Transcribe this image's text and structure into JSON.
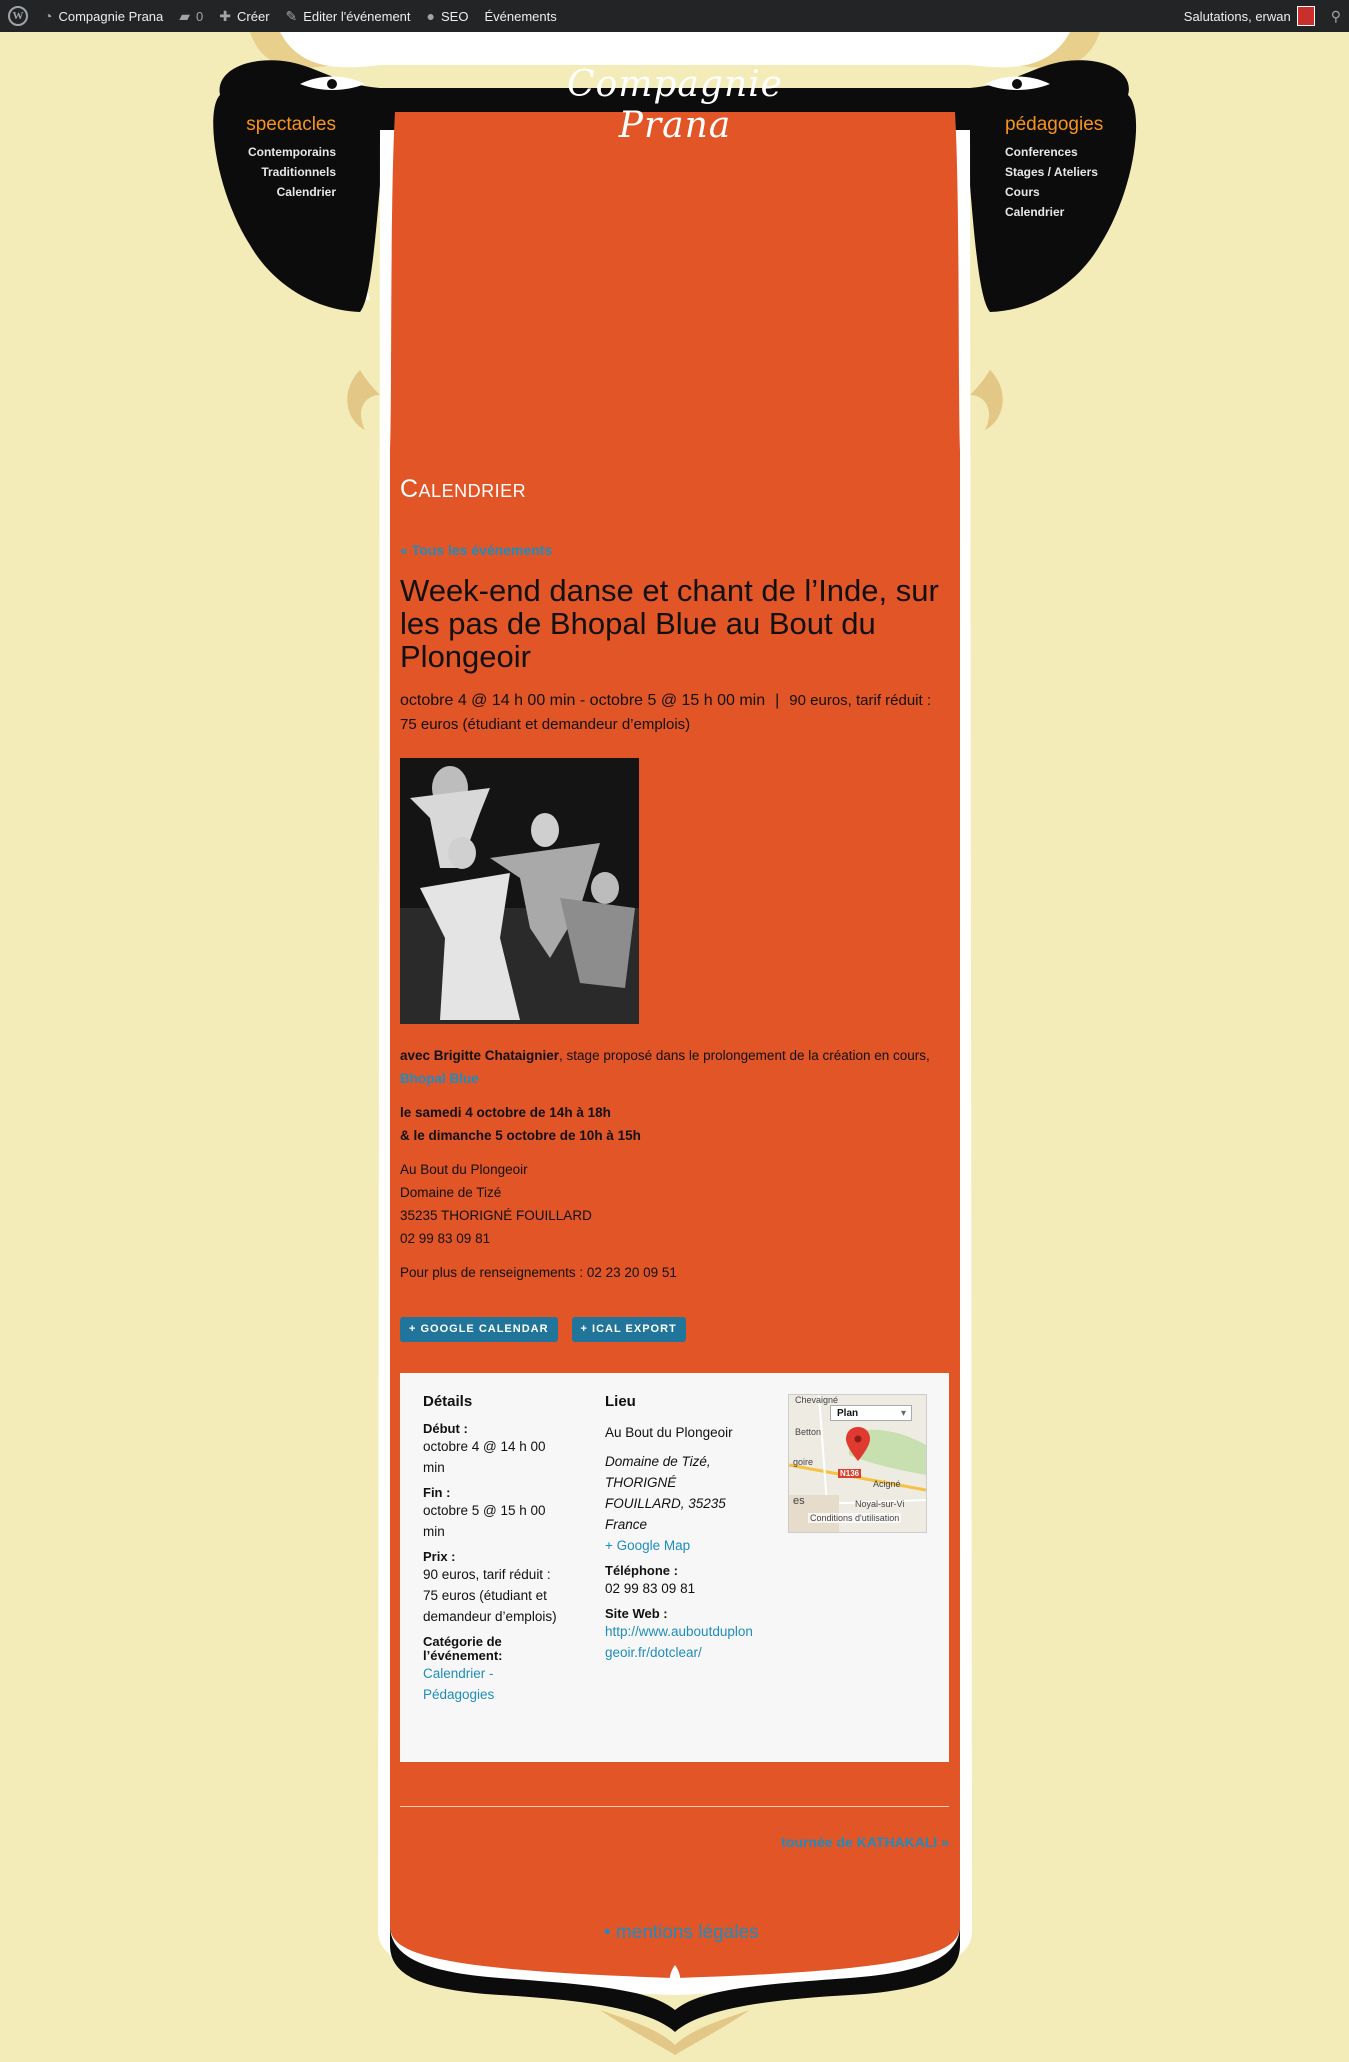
{
  "adminbar": {
    "site_name": "Compagnie Prana",
    "comments_count": "0",
    "create_label": "Créer",
    "edit_label": "Editer l'événement",
    "seo_label": "SEO",
    "events_label": "Événements",
    "greeting": "Salutations, erwan"
  },
  "header": {
    "title": "Compagnie Prana",
    "left_menu": {
      "heading": "spectacles",
      "items": [
        "Contemporains",
        "Traditionnels",
        "Calendrier"
      ]
    },
    "right_menu": {
      "heading": "pédagogies",
      "items": [
        "Conferences",
        "Stages / Ateliers",
        "Cours",
        "Calendrier"
      ]
    }
  },
  "page": {
    "heading": "Calendrier",
    "back_link": "« Tous les événements",
    "event_title": "Week-end danse et chant de l’Inde, sur les pas de Bhopal Blue au Bout du Plongeoir",
    "date_range": "octobre 4 @ 14 h 00 min - octobre 5 @ 15 h 00 min",
    "price": "90 euros, tarif réduit : 75 euros (étudiant et demandeur d’emplois)",
    "intro_bold": "avec Brigitte Chataignier",
    "intro_text": ", stage proposé dans le prolongement de la création en cours, ",
    "intro_link": "Bhopal Blue",
    "schedule_1": "le samedi 4 octobre de 14h à 18h",
    "schedule_2": "& le dimanche 5 octobre de 10h à 15h",
    "address": [
      "Au Bout du Plongeoir",
      "Domaine de Tizé",
      "35235 THORIGNÉ FOUILLARD",
      "02 99 83 09 81"
    ],
    "info": "Pour plus de renseignements : 02 23 20 09 51",
    "btn_google": "+ Google Calendar",
    "btn_ical": "+ iCal Export"
  },
  "details": {
    "heading": "Détails",
    "start_label": "Début :",
    "start_value": "octobre 4 @ 14 h 00 min",
    "end_label": "Fin :",
    "end_value": "octobre 5 @ 15 h 00 min",
    "price_label": "Prix :",
    "price_value": "90 euros, tarif réduit : 75 euros (étudiant et demandeur d’emplois)",
    "category_label": "Catégorie de l’événement:",
    "category_value": "Calendrier - Pédagogies"
  },
  "venue": {
    "heading": "Lieu",
    "name": "Au Bout du Plongeoir",
    "address": "Domaine de Tizé, THORIGNÉ FOUILLARD, 35235 France",
    "map_link": "+ Google Map",
    "phone_label": "Téléphone :",
    "phone_value": "02 99 83 09 81",
    "site_label": "Site Web :",
    "site_value": "http://www.auboutduplongeoir.fr/dotclear/"
  },
  "map": {
    "type_label": "Plan",
    "places": [
      "Chevaigné",
      "Betton",
      "goire",
      "Acigné",
      "Noyal-sur-Vi",
      "es"
    ],
    "road": "N136",
    "terms": "Conditions d'utilisation"
  },
  "footer": {
    "next_link": "tournée de KATHAKALI »",
    "legal": "• mentions légales"
  },
  "colors": {
    "orange": "#e25526",
    "cream": "#f4ecb8",
    "black": "#111111",
    "accent_orange": "#f7941d",
    "link_blue": "#1e8cbe"
  }
}
